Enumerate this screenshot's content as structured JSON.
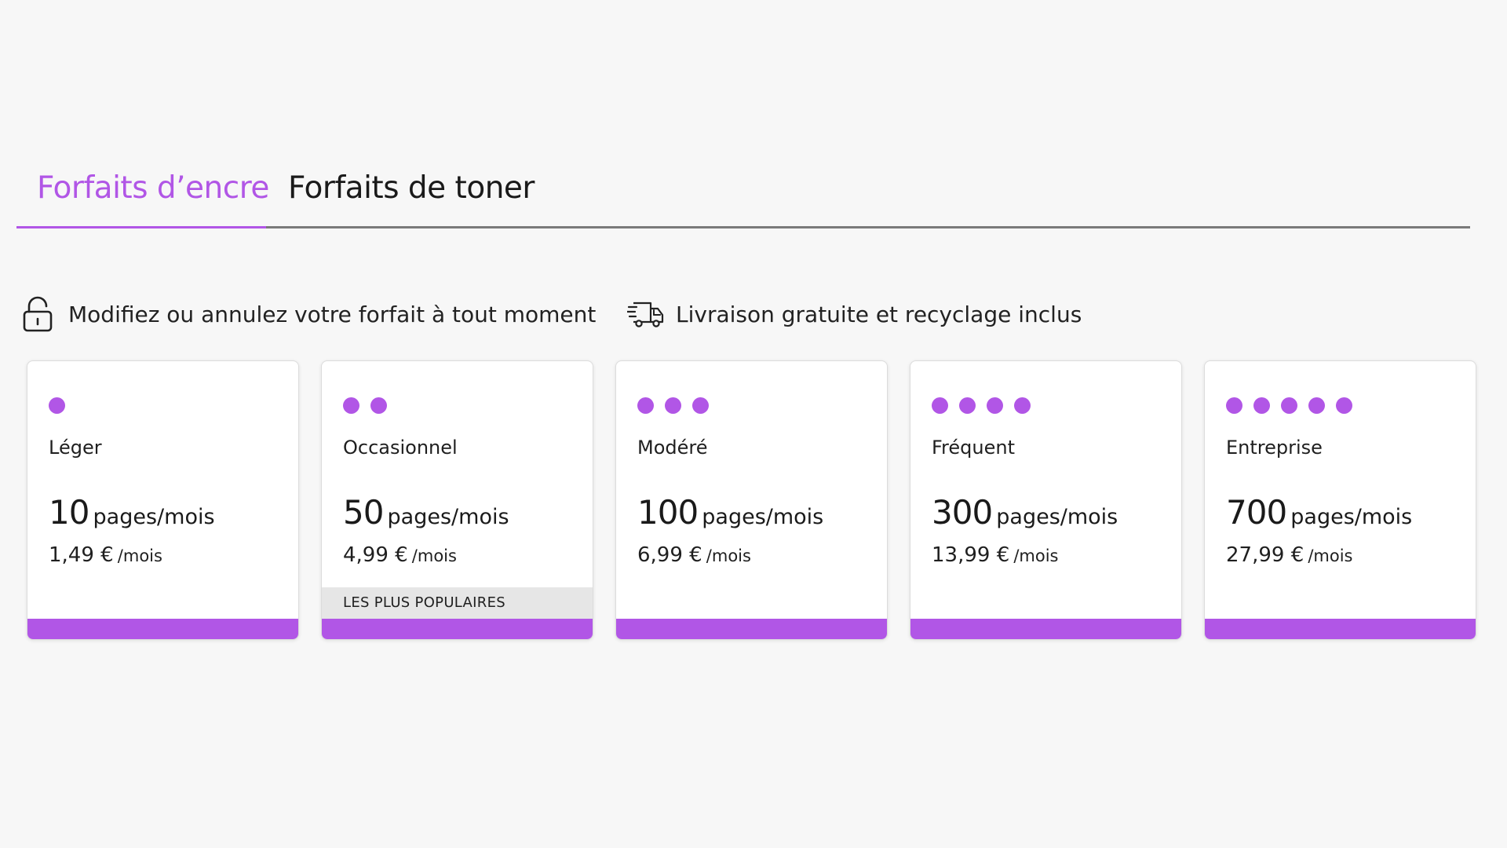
{
  "colors": {
    "accent": "#b156e6",
    "background": "#f7f7f7",
    "text": "#1a1a1a",
    "badge_bg": "#e6e6e6"
  },
  "tabs": [
    {
      "label": "Forfaits d’encre",
      "active": true
    },
    {
      "label": "Forfaits de toner",
      "active": false
    }
  ],
  "features": [
    {
      "icon": "open-lock-icon",
      "text": "Modifiez ou annulez votre forfait à tout moment"
    },
    {
      "icon": "delivery-truck-icon",
      "text": "Livraison gratuite et recyclage inclus"
    }
  ],
  "plans": [
    {
      "dots": 1,
      "name": "Léger",
      "pages": "10",
      "pages_unit": "pages/mois",
      "price": "1,49 €",
      "price_unit": "/mois",
      "badge": ""
    },
    {
      "dots": 2,
      "name": "Occasionnel",
      "pages": "50",
      "pages_unit": "pages/mois",
      "price": "4,99 €",
      "price_unit": "/mois",
      "badge": "LES PLUS POPULAIRES"
    },
    {
      "dots": 3,
      "name": "Modéré",
      "pages": "100",
      "pages_unit": "pages/mois",
      "price": "6,99 €",
      "price_unit": "/mois",
      "badge": ""
    },
    {
      "dots": 4,
      "name": "Fréquent",
      "pages": "300",
      "pages_unit": "pages/mois",
      "price": "13,99 €",
      "price_unit": "/mois",
      "badge": ""
    },
    {
      "dots": 5,
      "name": "Entreprise",
      "pages": "700",
      "pages_unit": "pages/mois",
      "price": "27,99 €",
      "price_unit": "/mois",
      "badge": ""
    }
  ]
}
